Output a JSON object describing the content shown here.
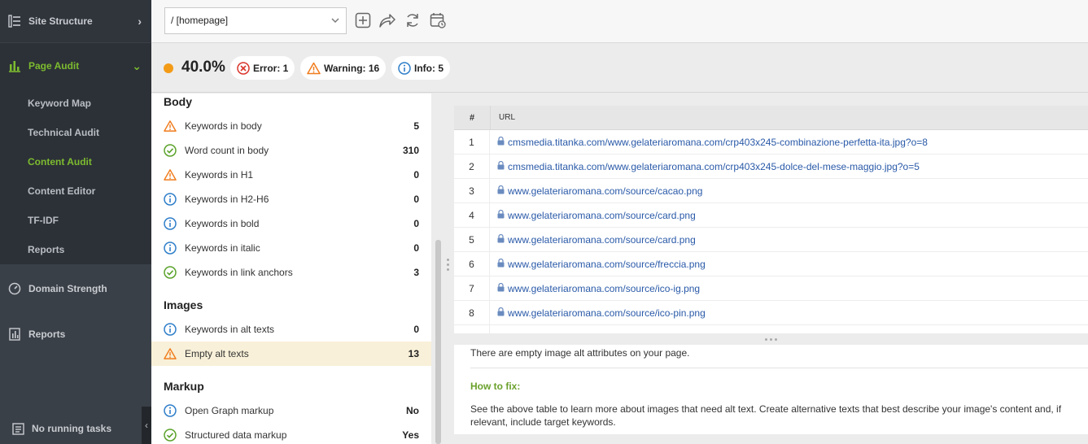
{
  "sidebar": {
    "site_structure": "Site Structure",
    "page_audit": "Page Audit",
    "sub_items": [
      "Keyword Map",
      "Technical Audit",
      "Content Audit",
      "Content Editor",
      "TF-IDF",
      "Reports"
    ],
    "active_sub_index": 2,
    "domain_strength": "Domain Strength",
    "reports": "Reports",
    "tasks": "No running tasks",
    "accent_color": "#7dbb2f"
  },
  "topbar": {
    "page_select_value": "/ [homepage]",
    "icons": [
      "add-page-icon",
      "share-icon",
      "refresh-icon",
      "schedule-icon"
    ]
  },
  "score": {
    "value": "40.0%",
    "dot_color": "#f39b17",
    "error_label": "Error: 1",
    "warning_label": "Warning: 16",
    "info_label": "Info: 5"
  },
  "groups": {
    "body": {
      "title": "Body",
      "items": [
        {
          "status": "warning",
          "label": "Keywords in body",
          "value": "5"
        },
        {
          "status": "ok",
          "label": "Word count in body",
          "value": "310"
        },
        {
          "status": "warning",
          "label": "Keywords in H1",
          "value": "0"
        },
        {
          "status": "info",
          "label": "Keywords in H2-H6",
          "value": "0"
        },
        {
          "status": "info",
          "label": "Keywords in bold",
          "value": "0"
        },
        {
          "status": "info",
          "label": "Keywords in italic",
          "value": "0"
        },
        {
          "status": "ok",
          "label": "Keywords in link anchors",
          "value": "3"
        }
      ]
    },
    "images": {
      "title": "Images",
      "items": [
        {
          "status": "info",
          "label": "Keywords in alt texts",
          "value": "0"
        },
        {
          "status": "warning",
          "label": "Empty alt texts",
          "value": "13"
        }
      ]
    },
    "markup": {
      "title": "Markup",
      "items": [
        {
          "status": "info",
          "label": "Open Graph markup",
          "value": "No"
        },
        {
          "status": "ok",
          "label": "Structured data markup",
          "value": "Yes"
        }
      ]
    }
  },
  "table": {
    "col_num": "#",
    "col_url": "URL",
    "rows": [
      {
        "num": "1",
        "url": "cmsmedia.titanka.com/www.gelateriaromana.com/crp403x245-combinazione-perfetta-ita.jpg?o=8"
      },
      {
        "num": "2",
        "url": "cmsmedia.titanka.com/www.gelateriaromana.com/crp403x245-dolce-del-mese-maggio.jpg?o=5"
      },
      {
        "num": "3",
        "url": "www.gelateriaromana.com/source/cacao.png"
      },
      {
        "num": "4",
        "url": "www.gelateriaromana.com/source/card.png"
      },
      {
        "num": "5",
        "url": "www.gelateriaromana.com/source/card.png"
      },
      {
        "num": "6",
        "url": "www.gelateriaromana.com/source/freccia.png"
      },
      {
        "num": "7",
        "url": "www.gelateriaromana.com/source/ico-ig.png"
      },
      {
        "num": "8",
        "url": "www.gelateriaromana.com/source/ico-pin.png"
      }
    ]
  },
  "details": {
    "description": "There are empty image alt attributes on your page.",
    "how_to_fix_label": "How to fix:",
    "fix_text": "See the above table to learn more about images that need alt text. Create alternative texts that best describe your image's content and, if relevant, include target keywords."
  }
}
